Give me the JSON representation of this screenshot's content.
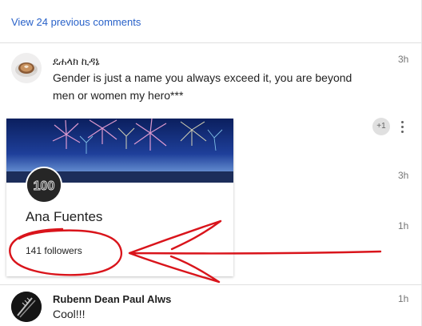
{
  "view_previous_label": "View 24 previous comments",
  "comments": [
    {
      "author": "ደሐላክ ኪዳኔ",
      "text_line1": "Gender is just a name you always exceed it, you are beyond",
      "text_line2": "men or women my hero***",
      "time": "3h"
    },
    {
      "author": "Rubenn Dean Paul Alws",
      "text": "Cool!!!",
      "time": "1h"
    }
  ],
  "hidden_times": [
    "3h",
    "1h"
  ],
  "plus_one_label": "+1",
  "profile_card": {
    "name": "Ana Fuentes",
    "followers": "141 followers",
    "avatar_badge": "100"
  },
  "colors": {
    "link": "#2962c9",
    "annotation": "#d9141b"
  }
}
